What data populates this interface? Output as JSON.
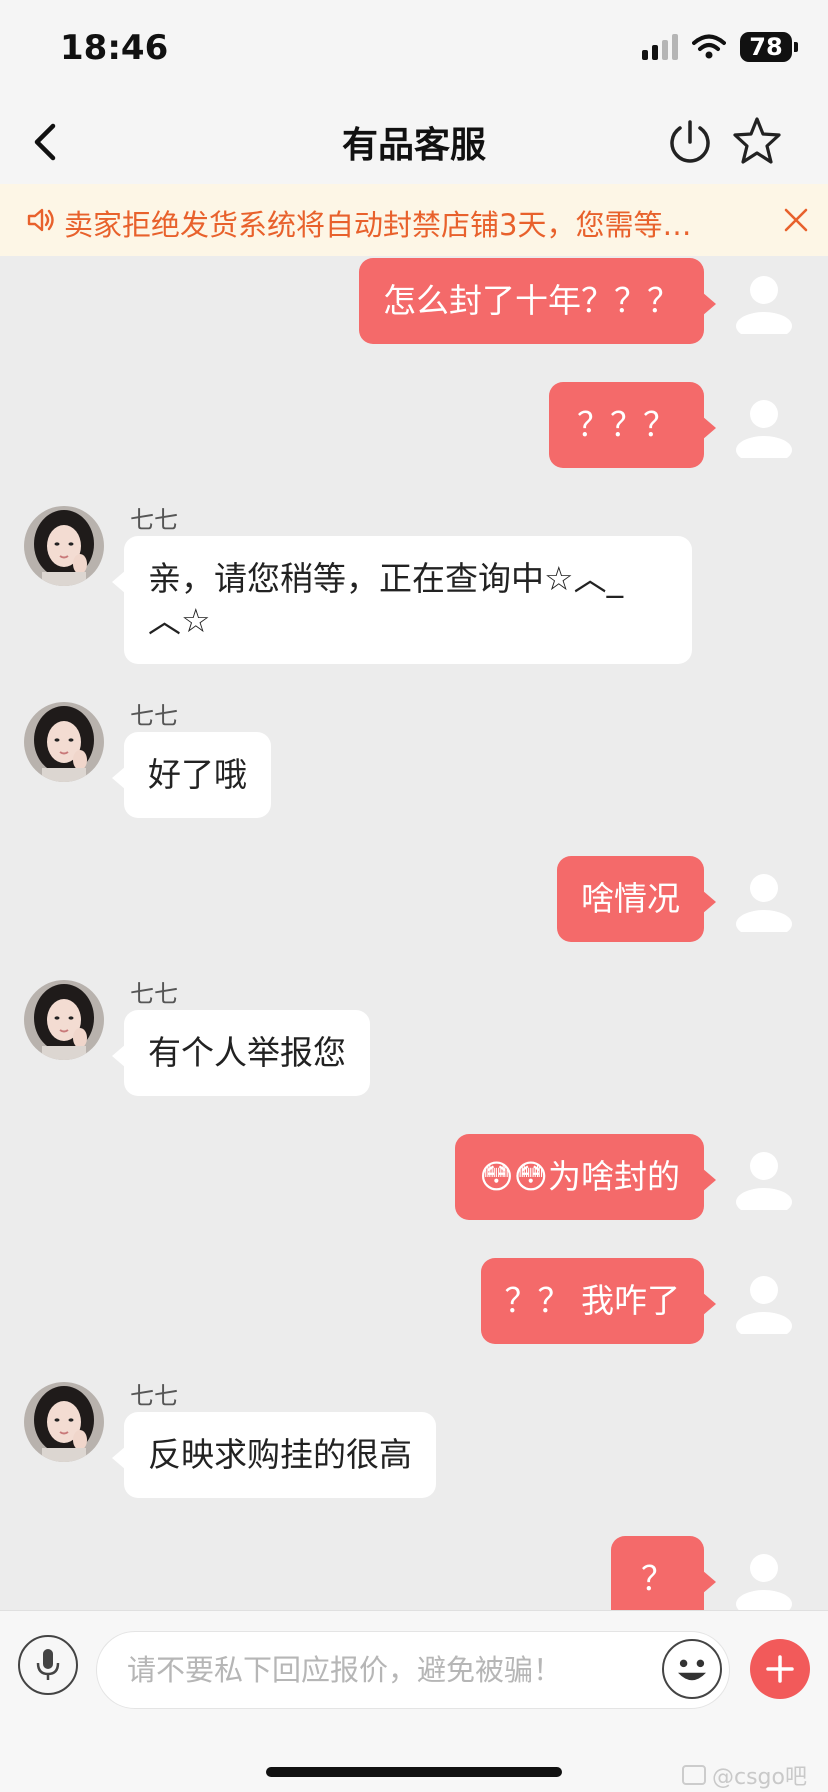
{
  "status_bar": {
    "time": "18:46",
    "battery": "78"
  },
  "nav": {
    "title": "有品客服"
  },
  "notice": {
    "text": "卖家拒绝发货系统将自动封禁店铺3天，您需等…"
  },
  "agent_name": "七七",
  "messages": [
    {
      "from": "me",
      "text": "怎么封了十年？？？"
    },
    {
      "from": "me",
      "text": "？？？"
    },
    {
      "from": "agent",
      "name": "七七",
      "text": "亲，请您稍等，正在查询中☆︿_︿☆"
    },
    {
      "from": "agent",
      "name": "七七",
      "text": "好了哦"
    },
    {
      "from": "me",
      "text": "啥情况"
    },
    {
      "from": "agent",
      "name": "七七",
      "text": "有个人举报您"
    },
    {
      "from": "me",
      "text": "😳😳为啥封的"
    },
    {
      "from": "me",
      "text": "？？ 我咋了"
    },
    {
      "from": "agent",
      "name": "七七",
      "text": "反映求购挂的很高"
    },
    {
      "from": "me",
      "text": "？"
    }
  ],
  "input": {
    "placeholder": "请不要私下回应报价，避免被骗！"
  },
  "watermark": "@csgo吧",
  "icons": {
    "back": "chevron-left-icon",
    "power": "power-icon",
    "star": "star-outline-icon",
    "notice": "speaker-icon",
    "close": "close-icon",
    "mic": "microphone-icon",
    "emoji": "emoji-icon",
    "plus": "plus-icon"
  },
  "colors": {
    "accent": "#f46a6a",
    "notice_text": "#e8612c",
    "notice_bg": "#fdf6e6"
  }
}
